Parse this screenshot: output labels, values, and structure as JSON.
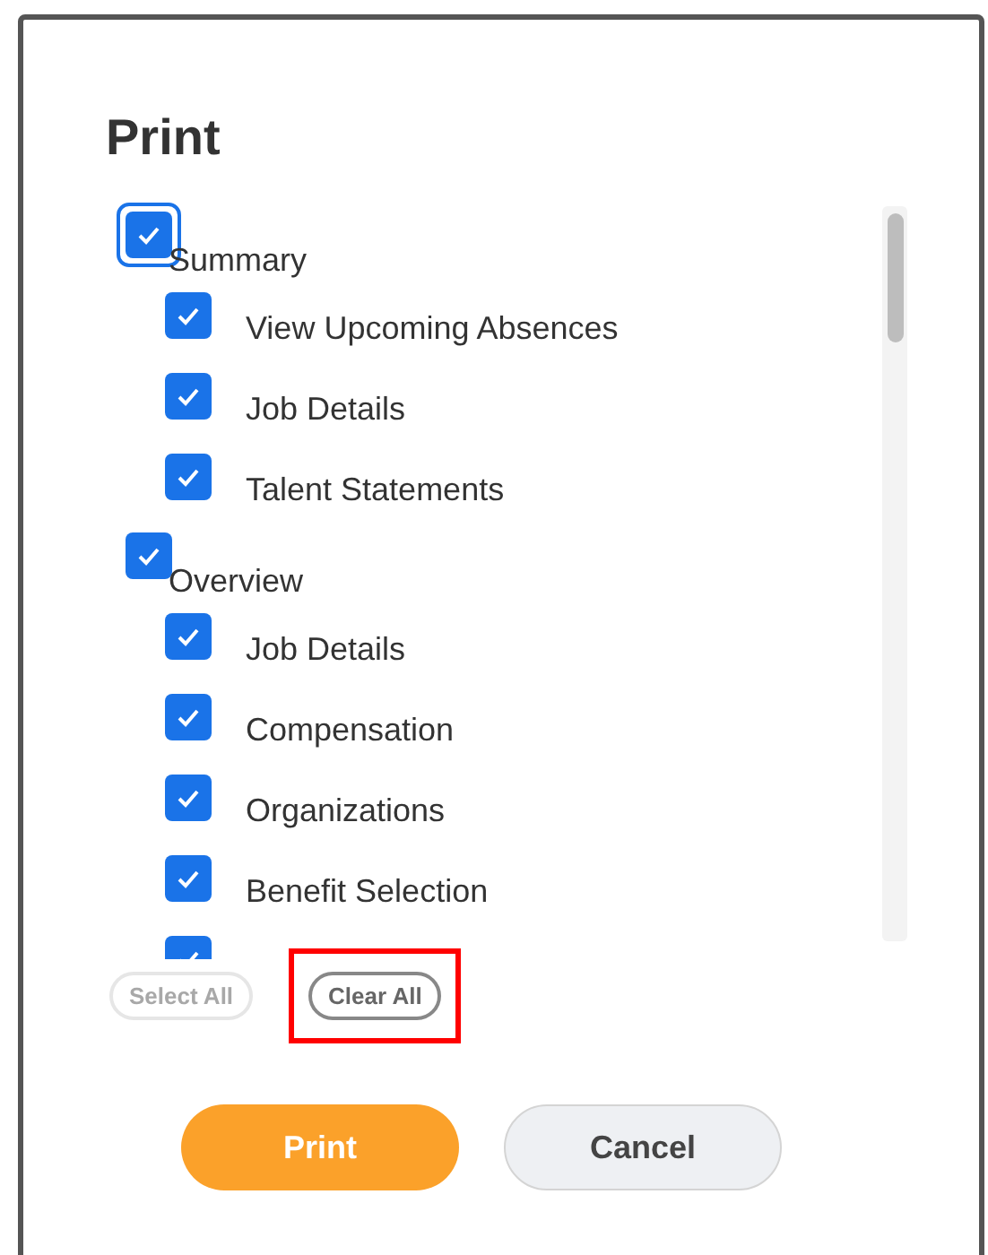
{
  "dialog": {
    "title": "Print",
    "groups": [
      {
        "label": "Summary",
        "checked": true,
        "focused": true,
        "children": [
          {
            "label": "View Upcoming Absences",
            "checked": true
          },
          {
            "label": "Job Details",
            "checked": true
          },
          {
            "label": "Talent Statements",
            "checked": true
          }
        ]
      },
      {
        "label": "Overview",
        "checked": true,
        "focused": false,
        "children": [
          {
            "label": "Job Details",
            "checked": true
          },
          {
            "label": "Compensation",
            "checked": true
          },
          {
            "label": "Organizations",
            "checked": true
          },
          {
            "label": "Benefit Selection",
            "checked": true
          },
          {
            "checked": true
          }
        ]
      }
    ],
    "list_actions": [
      {
        "label": "Select All",
        "disabled": true,
        "highlighted": false
      },
      {
        "label": "Clear All",
        "disabled": false,
        "highlighted": true
      }
    ],
    "buttons": [
      {
        "label": "Print",
        "kind": "primary"
      },
      {
        "label": "Cancel",
        "kind": "secondary"
      }
    ]
  }
}
